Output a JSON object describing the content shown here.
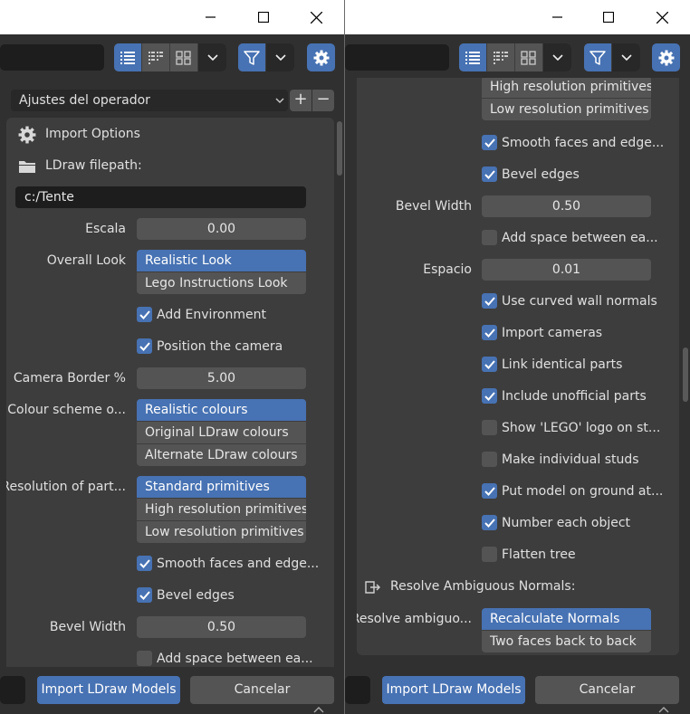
{
  "left": {
    "preset": {
      "label": "Ajustes del operador",
      "add": "+",
      "remove": "−"
    },
    "section_header": "Import Options",
    "filepath_label": "LDraw filepath:",
    "filepath_value": "c:/Tente",
    "scale": {
      "label": "Escala",
      "value": "0.00"
    },
    "overall_look": {
      "label": "Overall Look",
      "options": [
        "Realistic Look",
        "Lego Instructions Look"
      ],
      "selected": 0
    },
    "add_environment": "Add Environment",
    "position_camera": "Position the camera",
    "camera_border": {
      "label": "Camera Border %",
      "value": "5.00"
    },
    "colour_scheme": {
      "label": "Colour scheme o...",
      "options": [
        "Realistic colours",
        "Original LDraw colours",
        "Alternate LDraw colours"
      ],
      "selected": 0
    },
    "resolution": {
      "label": "Resolution of part...",
      "options": [
        "Standard primitives",
        "High resolution primitives",
        "Low resolution primitives"
      ],
      "selected": 0
    },
    "smooth": "Smooth faces and edge...",
    "bevel": "Bevel edges",
    "bevel_width": {
      "label": "Bevel Width",
      "value": "0.50"
    },
    "add_space": "Add space between ea..."
  },
  "right": {
    "res_opts": [
      "High resolution primitives",
      "Low resolution primitives"
    ],
    "smooth": "Smooth faces and edge...",
    "bevel": "Bevel edges",
    "bevel_width": {
      "label": "Bevel Width",
      "value": "0.50"
    },
    "add_space": "Add space between ea...",
    "gap": {
      "label": "Espacio",
      "value": "0.01"
    },
    "checks": [
      {
        "label": "Use curved wall normals",
        "checked": true
      },
      {
        "label": "Import cameras",
        "checked": true
      },
      {
        "label": "Link identical parts",
        "checked": true
      },
      {
        "label": "Include unofficial parts",
        "checked": true
      },
      {
        "label": "Show 'LEGO' logo on st...",
        "checked": false
      },
      {
        "label": "Make individual studs",
        "checked": false
      },
      {
        "label": "Put model on ground at...",
        "checked": true
      },
      {
        "label": "Number each object",
        "checked": true
      },
      {
        "label": "Flatten tree",
        "checked": false
      }
    ],
    "normals_header": "Resolve Ambiguous Normals:",
    "resolve": {
      "label": "Resolve ambiguo...",
      "options": [
        "Recalculate Normals",
        "Two faces back to back"
      ],
      "selected": 0
    }
  },
  "buttons": {
    "import": "Import LDraw Models",
    "cancel": "Cancelar"
  },
  "colors": {
    "accent": "#4772b3",
    "panel": "#3d3d3d",
    "background": "#303030",
    "field": "#545454"
  }
}
